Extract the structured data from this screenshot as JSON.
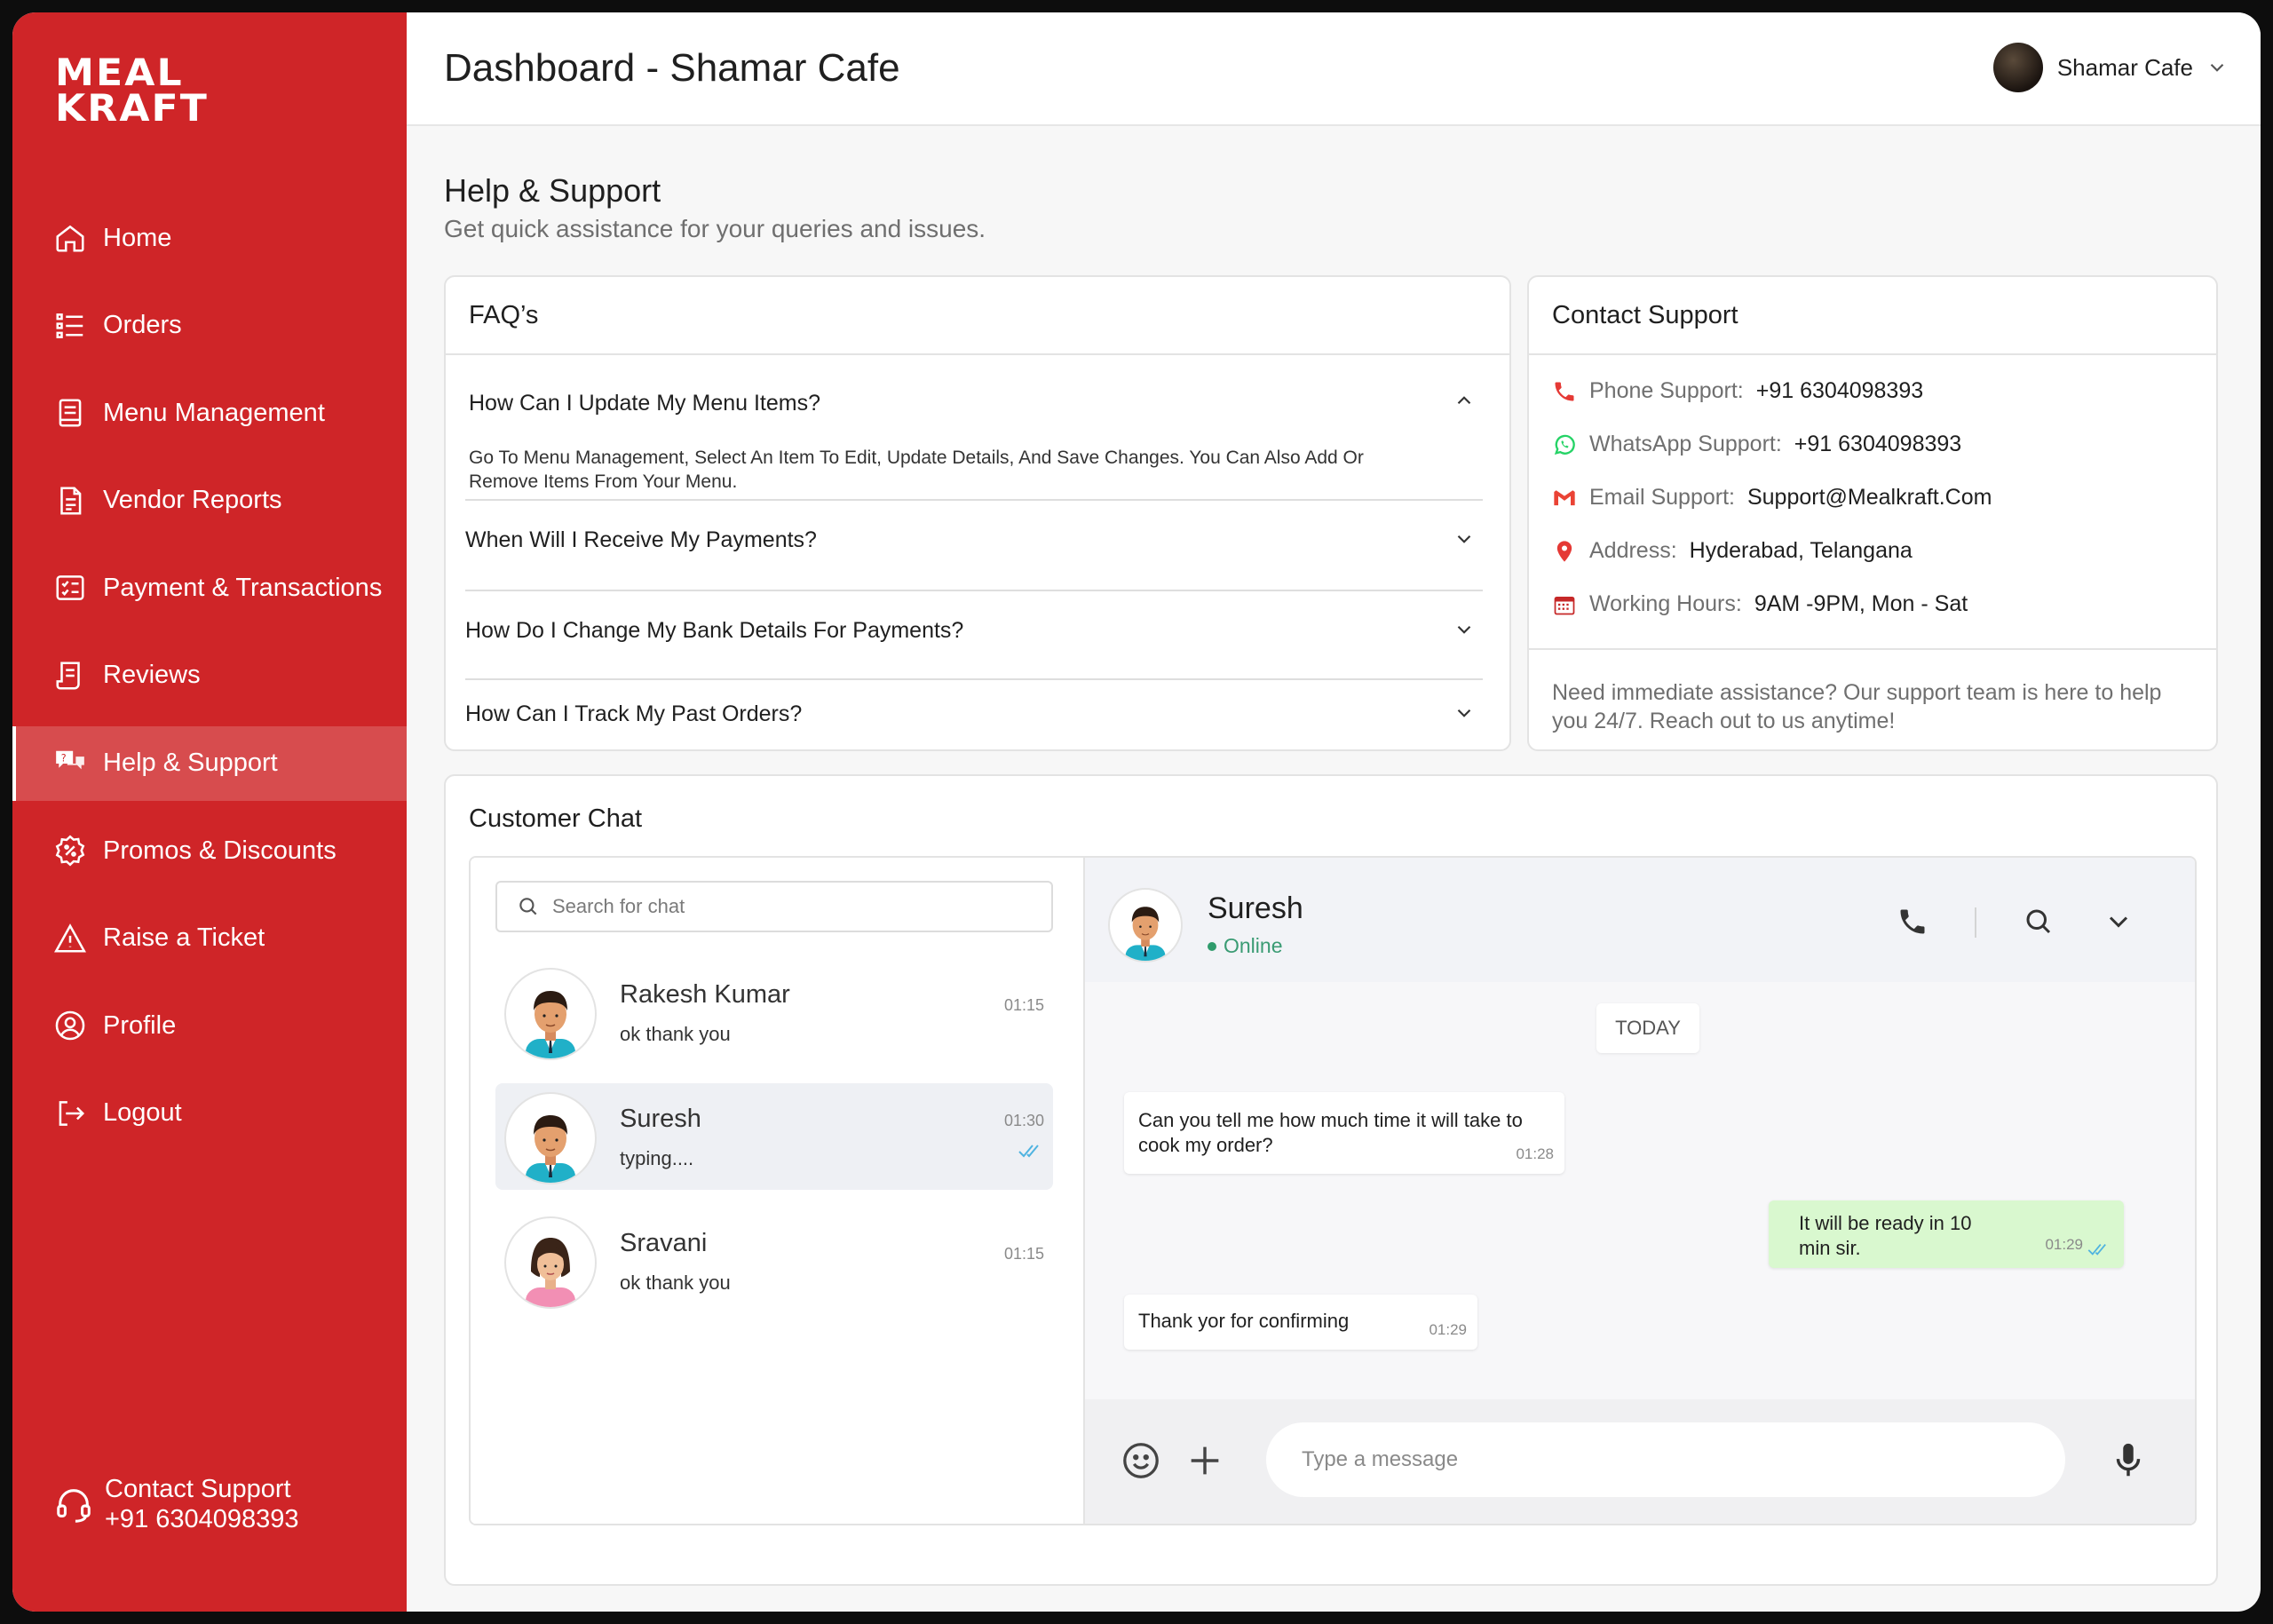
{
  "brand": {
    "logo_line1": "MEAL",
    "logo_line2": "KRAFT",
    "primary": "#cf2528"
  },
  "header": {
    "title": "Dashboard  - Shamar Cafe",
    "user_name": "Shamar Cafe"
  },
  "sidebar": {
    "items": [
      {
        "label": "Home",
        "icon": "home-icon"
      },
      {
        "label": "Orders",
        "icon": "list-icon"
      },
      {
        "label": "Menu Management",
        "icon": "menu-book-icon"
      },
      {
        "label": "Vendor Reports",
        "icon": "document-icon"
      },
      {
        "label": "Payment & Transactions",
        "icon": "checklist-icon"
      },
      {
        "label": "Reviews",
        "icon": "receipt-icon"
      },
      {
        "label": "Help & Support",
        "icon": "help-chat-icon",
        "active": true
      },
      {
        "label": "Promos & Discounts",
        "icon": "discount-badge-icon"
      },
      {
        "label": "Raise a Ticket",
        "icon": "warning-icon"
      },
      {
        "label": "Profile",
        "icon": "user-circle-icon"
      },
      {
        "label": "Logout",
        "icon": "logout-icon"
      }
    ],
    "contact_label": "Contact Support",
    "contact_phone": "+91 6304098393"
  },
  "help": {
    "title": "Help & Support",
    "subtitle": "Get quick assistance for your queries and issues."
  },
  "faq": {
    "title": "FAQ’s",
    "items": [
      {
        "question": "How Can I Update My Menu Items?",
        "answer": "Go To Menu Management, Select An Item To Edit, Update Details, And Save Changes. You Can Also Add Or Remove Items From Your Menu.",
        "expanded": true
      },
      {
        "question": "When Will I Receive My Payments?",
        "expanded": false
      },
      {
        "question": "How Do I Change My Bank Details For Payments?",
        "expanded": false
      },
      {
        "question": "How Can I Track My Past Orders?",
        "expanded": false
      }
    ]
  },
  "contact": {
    "title": "Contact Support",
    "rows": [
      {
        "label": "Phone Support:",
        "value": "+91 6304098393",
        "icon": "phone-icon",
        "color": "#e53935"
      },
      {
        "label": "WhatsApp Support:",
        "value": "+91 6304098393",
        "icon": "whatsapp-icon",
        "color": "#25d366"
      },
      {
        "label": "Email Support:",
        "value": "Support@Mealkraft.Com",
        "icon": "gmail-icon",
        "color": "#ea4335"
      },
      {
        "label": "Address:",
        "value": "Hyderabad, Telangana",
        "icon": "location-pin-icon",
        "color": "#e53935"
      },
      {
        "label": "Working Hours:",
        "value": "9AM -9PM, Mon - Sat",
        "icon": "calendar-icon",
        "color": "#c62828"
      }
    ],
    "note": "Need immediate assistance? Our support team is here to help you 24/7. Reach out to us anytime!"
  },
  "chat": {
    "title": "Customer Chat",
    "search_placeholder": "Search for chat",
    "contacts": [
      {
        "name": "Rakesh Kumar",
        "last": "ok thank you",
        "time": "01:15"
      },
      {
        "name": "Suresh",
        "last": "typing....",
        "time": "01:30",
        "selected": true
      },
      {
        "name": "Sravani",
        "last": "ok thank you",
        "time": "01:15"
      }
    ],
    "active": {
      "name": "Suresh",
      "status": "Online"
    },
    "day_label": "TODAY",
    "messages": [
      {
        "dir": "in",
        "text": "Can you tell me how much time it will take to cook my order?",
        "time": "01:28"
      },
      {
        "dir": "out",
        "text": "It will be ready in 10 min sir.",
        "time": "01:29"
      },
      {
        "dir": "in",
        "text": "Thank yor for confirming",
        "time": "01:29"
      }
    ],
    "input_placeholder": "Type a message"
  }
}
